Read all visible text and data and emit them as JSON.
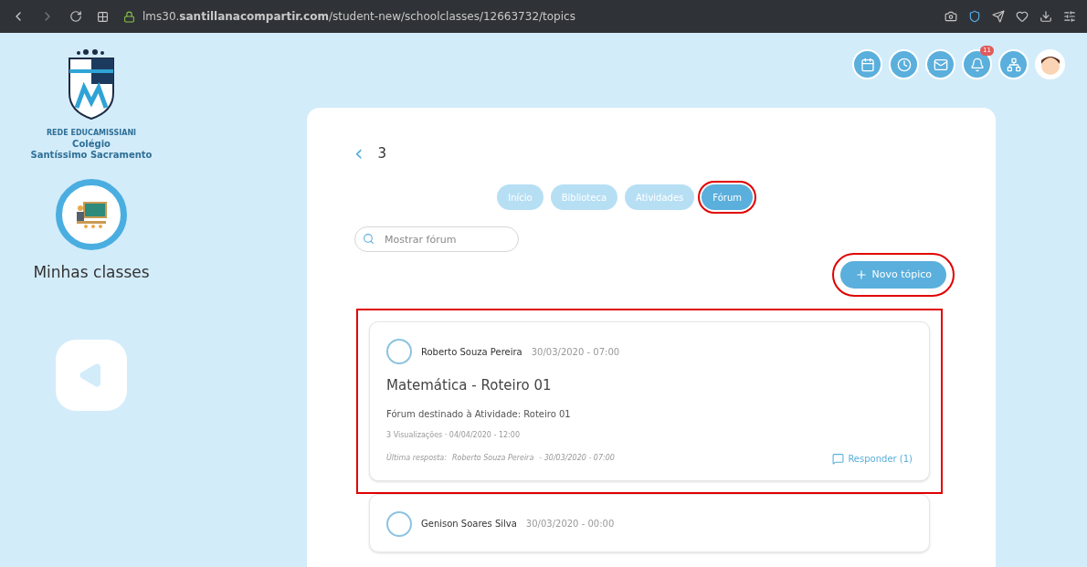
{
  "browser": {
    "url": "lms30.**santillanacompartir.com**/student-new/schoolclasses/12663732/topics"
  },
  "logo": {
    "network": "REDE EDUCAMISSIANI",
    "school_line_1": "Colégio",
    "school_line_2": "Santíssimo Sacramento"
  },
  "sidebar": {
    "item": "Minhas classes"
  },
  "header_icons": [
    {
      "kind": "calendar"
    },
    {
      "kind": "clock"
    },
    {
      "kind": "mail"
    },
    {
      "kind": "bell",
      "badge": "11"
    },
    {
      "kind": "network"
    },
    {
      "kind": "avatar"
    }
  ],
  "page": {
    "back": "‹",
    "title": "3"
  },
  "tabs": [
    {
      "label": "Início",
      "selected": false
    },
    {
      "label": "Biblioteca",
      "selected": false
    },
    {
      "label": "Atividades",
      "selected": false
    },
    {
      "label": "Fórum",
      "selected": true
    }
  ],
  "search": {
    "placeholder": "Mostrar fórum"
  },
  "new_topic_button": "Novo tópico",
  "topics": [
    {
      "author": "Roberto Souza Pereira",
      "date": "30/03/2020 - 07:00",
      "title": "Matemática - Roteiro 01",
      "description": "Fórum destinado à Atividade: Roteiro 01",
      "stats": "3 Visualizações · 04/04/2020 - 12:00",
      "last_reply_label": "Última resposta:",
      "last_reply_author": "Roberto Souza Pereira",
      "last_reply_date": "- 30/03/2020 - 07:00",
      "reply_button": "Responder (1)"
    },
    {
      "author": "Genison Soares Silva",
      "date": "30/03/2020 - 00:00"
    }
  ]
}
